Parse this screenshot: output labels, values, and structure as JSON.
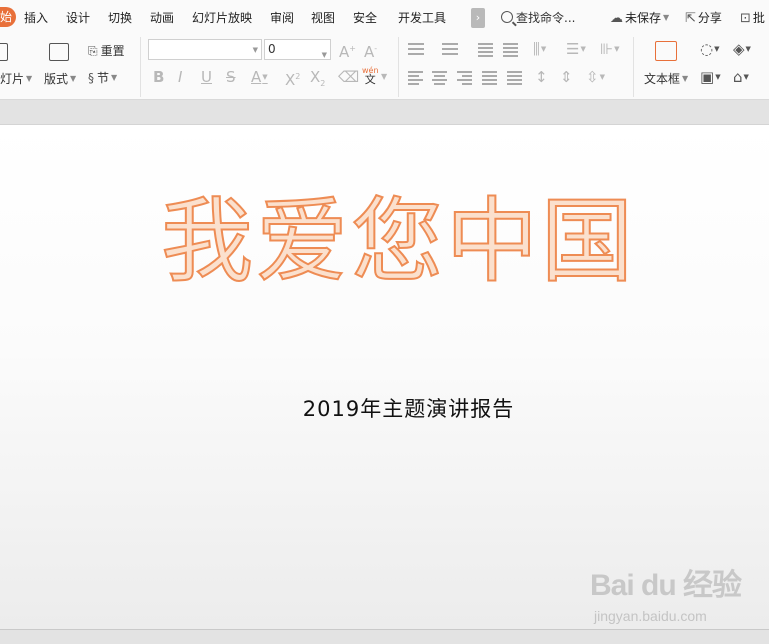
{
  "menubar": {
    "active_tab": "始",
    "tabs": [
      "插入",
      "设计",
      "切换",
      "动画",
      "幻灯片放映",
      "审阅",
      "视图",
      "安全",
      "开发工具"
    ],
    "more": "›",
    "search_placeholder": "查找命令...",
    "unsaved": "未保存",
    "share": "分享",
    "annotate": "批"
  },
  "toolbar": {
    "slide_label": "灯片",
    "layout_label": "版式",
    "reset_label": "重置",
    "section_label": "节",
    "font_name": "",
    "font_size": "0",
    "textbox_label": "文本框",
    "phonetic_top": "wén",
    "phonetic_bottom": "文"
  },
  "slide": {
    "title": "我爱您中国",
    "subtitle": "2019年主题演讲报告"
  },
  "watermark": {
    "brand": "Bai du 经验",
    "site": "jingyan.baidu.com"
  },
  "colors": {
    "accent": "#e8703a",
    "title_fill": "#fbe0cd",
    "title_stroke": "#ee8c54"
  }
}
